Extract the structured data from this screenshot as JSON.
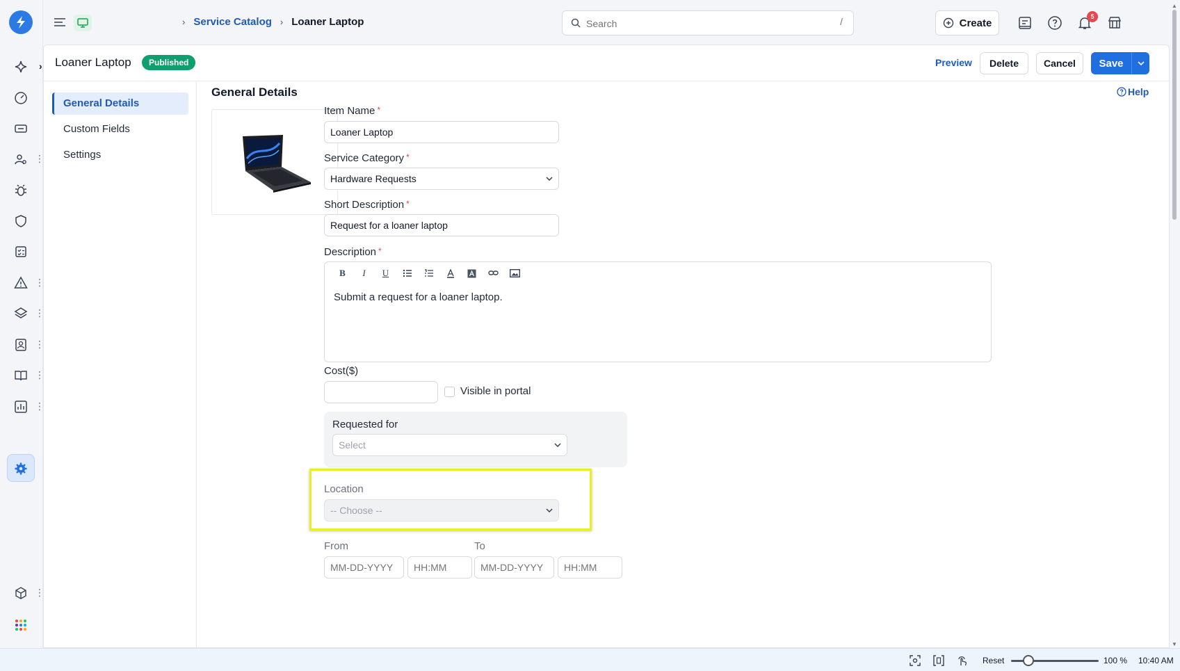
{
  "breadcrumb": {
    "link": "Service Catalog",
    "current": "Loaner Laptop"
  },
  "search": {
    "placeholder": "Search",
    "shortcut": "/"
  },
  "topbar": {
    "create_label": "Create",
    "notification_count": "5"
  },
  "header": {
    "title": "Loaner Laptop",
    "status": "Published",
    "preview": "Preview",
    "delete": "Delete",
    "cancel": "Cancel",
    "save": "Save"
  },
  "nav": {
    "items": [
      {
        "label": "General Details",
        "active": true
      },
      {
        "label": "Custom Fields",
        "active": false
      },
      {
        "label": "Settings",
        "active": false
      }
    ]
  },
  "content": {
    "section_title": "General Details",
    "help": "Help"
  },
  "form": {
    "item_name": {
      "label": "Item Name",
      "value": "Loaner Laptop",
      "required": "*"
    },
    "service_category": {
      "label": "Service Category",
      "value": "Hardware Requests",
      "required": "*"
    },
    "short_description": {
      "label": "Short Description",
      "value": "Request for a loaner laptop",
      "required": "*"
    },
    "description": {
      "label": "Description",
      "required": "*",
      "value": "Submit a request for a loaner laptop.",
      "toolbar": [
        "B",
        "I",
        "U"
      ]
    },
    "cost": {
      "label": "Cost($)",
      "value": ""
    },
    "visible_in_portal": {
      "label": "Visible in portal",
      "checked": false
    },
    "requested_for": {
      "label": "Requested for",
      "placeholder": "Select"
    },
    "location": {
      "label": "Location",
      "placeholder": "-- Choose --"
    },
    "from": {
      "label": "From",
      "date_placeholder": "MM-DD-YYYY",
      "time_placeholder": "HH:MM"
    },
    "to": {
      "label": "To",
      "date_placeholder": "MM-DD-YYYY",
      "time_placeholder": "HH:MM"
    }
  },
  "statusbar": {
    "reset": "Reset",
    "zoom": "100 %",
    "time": "10:40 AM",
    "zoom_level": 0.2
  },
  "colors": {
    "brand": "#2c7be5",
    "primary": "#1f6fe0",
    "published": "#0e9f6e",
    "highlight": "#e9f020"
  }
}
